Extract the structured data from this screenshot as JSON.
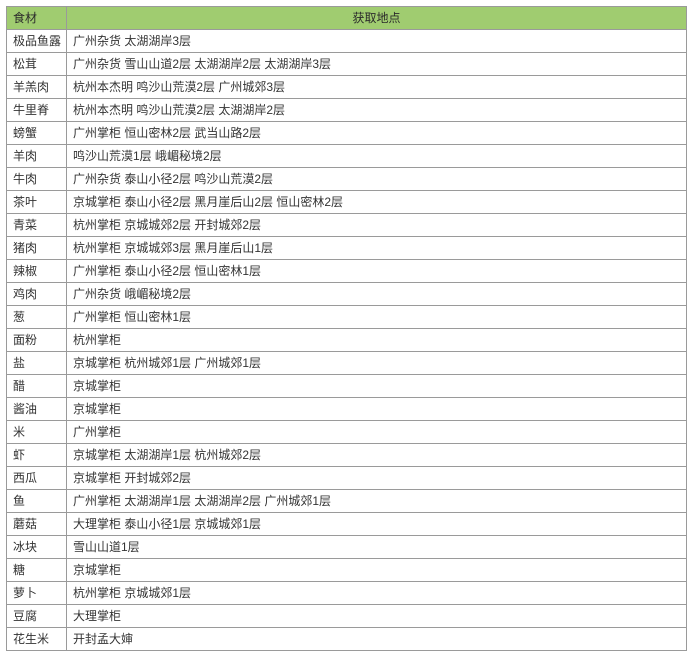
{
  "headers": {
    "ingredient": "食材",
    "location": "获取地点"
  },
  "rows": [
    {
      "ingredient": "极品鱼露",
      "location": "广州杂货 太湖湖岸3层"
    },
    {
      "ingredient": "松茸",
      "location": "广州杂货 雪山山道2层 太湖湖岸2层 太湖湖岸3层"
    },
    {
      "ingredient": "羊羔肉",
      "location": "杭州本杰明 鸣沙山荒漠2层 广州城郊3层"
    },
    {
      "ingredient": "牛里脊",
      "location": "杭州本杰明 鸣沙山荒漠2层 太湖湖岸2层"
    },
    {
      "ingredient": "螃蟹",
      "location": "广州掌柜 恒山密林2层 武当山路2层"
    },
    {
      "ingredient": "羊肉",
      "location": "鸣沙山荒漠1层 峨嵋秘境2层"
    },
    {
      "ingredient": "牛肉",
      "location": "广州杂货 泰山小径2层 鸣沙山荒漠2层"
    },
    {
      "ingredient": "茶叶",
      "location": "京城掌柜 泰山小径2层 黑月崖后山2层 恒山密林2层"
    },
    {
      "ingredient": "青菜",
      "location": "杭州掌柜 京城城郊2层 开封城郊2层"
    },
    {
      "ingredient": "猪肉",
      "location": "杭州掌柜 京城城郊3层 黑月崖后山1层"
    },
    {
      "ingredient": "辣椒",
      "location": "广州掌柜 泰山小径2层 恒山密林1层"
    },
    {
      "ingredient": "鸡肉",
      "location": "广州杂货 峨嵋秘境2层"
    },
    {
      "ingredient": "葱",
      "location": "广州掌柜 恒山密林1层"
    },
    {
      "ingredient": "面粉",
      "location": "杭州掌柜"
    },
    {
      "ingredient": "盐",
      "location": "京城掌柜 杭州城郊1层 广州城郊1层"
    },
    {
      "ingredient": "醋",
      "location": "京城掌柜"
    },
    {
      "ingredient": "酱油",
      "location": "京城掌柜"
    },
    {
      "ingredient": "米",
      "location": "广州掌柜"
    },
    {
      "ingredient": "虾",
      "location": "京城掌柜 太湖湖岸1层 杭州城郊2层"
    },
    {
      "ingredient": "西瓜",
      "location": "京城掌柜 开封城郊2层"
    },
    {
      "ingredient": "鱼",
      "location": "广州掌柜 太湖湖岸1层 太湖湖岸2层 广州城郊1层"
    },
    {
      "ingredient": "蘑菇",
      "location": "大理掌柜 泰山小径1层 京城城郊1层"
    },
    {
      "ingredient": "冰块",
      "location": "雪山山道1层"
    },
    {
      "ingredient": "糖",
      "location": "京城掌柜"
    },
    {
      "ingredient": "萝卜",
      "location": "杭州掌柜 京城城郊1层"
    },
    {
      "ingredient": "豆腐",
      "location": "大理掌柜"
    },
    {
      "ingredient": "花生米",
      "location": "开封孟大婶"
    }
  ]
}
